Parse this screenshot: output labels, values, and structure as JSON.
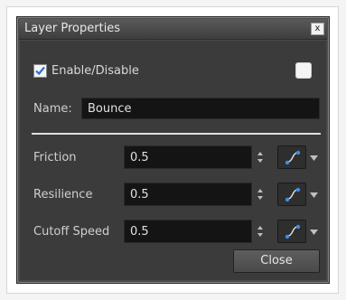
{
  "window": {
    "title": "Layer Properties",
    "close_glyph": "x"
  },
  "enable": {
    "label": "Enable/Disable",
    "checked": true
  },
  "color_swatch": {
    "color": "#f4f4f4"
  },
  "name": {
    "label": "Name:",
    "value": "Bounce"
  },
  "fields": [
    {
      "label": "Friction",
      "value": "0.5"
    },
    {
      "label": "Resilience",
      "value": "0.5"
    },
    {
      "label": "Cutoff Speed",
      "value": "0.5"
    }
  ],
  "close_button": {
    "label": "Close"
  },
  "icons": {
    "spin": "up-down-stepper-icon",
    "function": "function-curve-icon",
    "dropdown": "chevron-down-icon"
  },
  "colors": {
    "accent": "#3a8ee6",
    "panel": "#3b3b3b",
    "input": "#141414"
  }
}
